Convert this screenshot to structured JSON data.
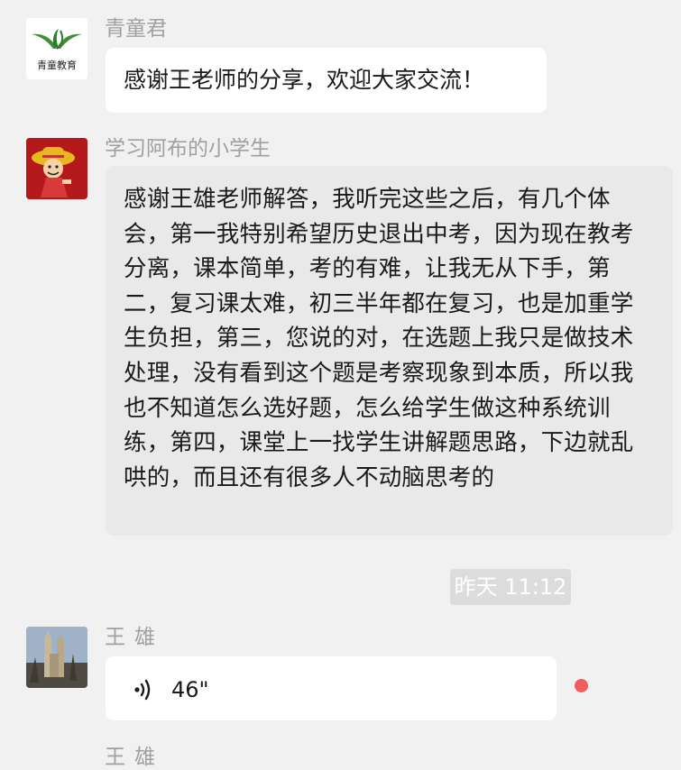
{
  "chat": {
    "messages": [
      {
        "sender": "青童君",
        "avatar_icon": "qingtong-logo-icon",
        "avatar_text": "青童教育",
        "text": "感谢王老师的分享，欢迎大家交流！"
      },
      {
        "sender": "学习阿布的小学生",
        "avatar_icon": "cartoon-avatar-icon",
        "text": "感谢王雄老师解答，我听完这些之后，有几个体会，第一我特别希望历史退出中考，因为现在教考分离，课本简单，考的有难，让我无从下手，第二，复习课太难，初三半年都在复习，也是加重学生负担，第三，您说的对，在选题上我只是做技术处理，没有看到这个题是考察现象到本质，所以我也不知道怎么选好题，怎么给学生做这种系统训练，第四，课堂上一找学生讲解题思路，下边就乱哄的，而且还有很多人不动脑思考的"
      },
      {
        "sender": "王雄",
        "avatar_icon": "building-photo-icon",
        "voice_icon": "voice-wave-icon",
        "duration": "46\"",
        "unread_color": "#f25d5d"
      }
    ],
    "timestamp": "昨天 11:12",
    "next_sender": "王雄"
  }
}
